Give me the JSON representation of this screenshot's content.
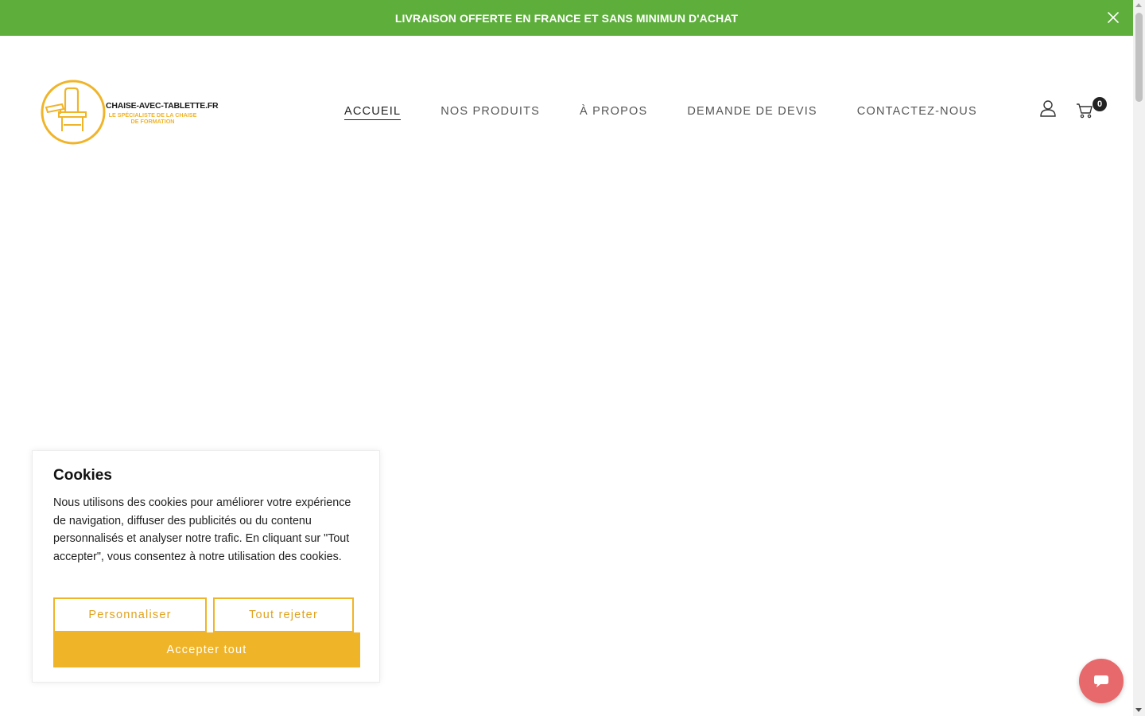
{
  "announcement": {
    "text": "LIVRAISON OFFERTE EN FRANCE ET SANS MINIMUN D'ACHAT",
    "close_icon": "close-icon"
  },
  "header": {
    "logo": {
      "name": "CHAISE-AVEC-TABLETTE.FR",
      "tagline": "LE SPÉCIALISTE DE LA CHAISE DE FORMATION"
    },
    "nav": [
      {
        "label": "ACCUEIL",
        "active": true
      },
      {
        "label": "NOS PRODUITS",
        "active": false
      },
      {
        "label": "À PROPOS",
        "active": false
      },
      {
        "label": "DEMANDE DE DEVIS",
        "active": false
      },
      {
        "label": "CONTACTEZ-NOUS",
        "active": false
      }
    ],
    "account_icon": "user-icon",
    "cart_icon": "cart-icon",
    "cart_count": "0"
  },
  "cookie_banner": {
    "title": "Cookies",
    "text": "Nous utilisons des cookies pour améliorer votre expérience de navigation, diffuser des publicités ou du contenu personnalisés et analyser notre trafic. En cliquant sur \"Tout accepter\", vous consentez à notre utilisation des cookies.",
    "customize_label": "Personnaliser",
    "reject_label": "Tout rejeter",
    "accept_label": "Accepter tout"
  },
  "chat": {
    "icon": "chat-icon"
  },
  "colors": {
    "announcement_bg": "#5eae3c",
    "accent": "#f0b429",
    "chat_bg": "#e8696b"
  }
}
